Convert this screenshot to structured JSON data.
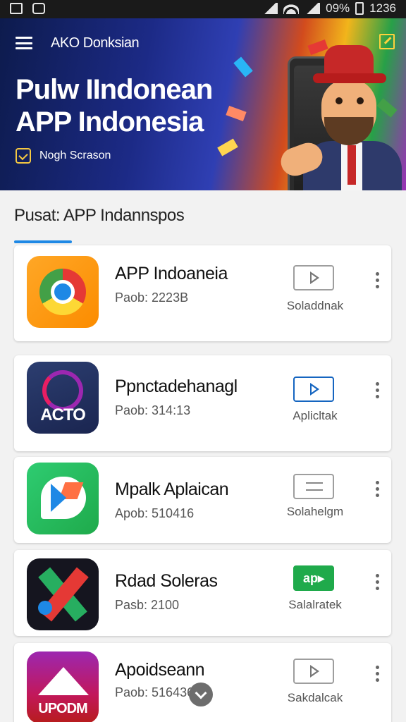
{
  "status_bar": {
    "battery": "09%",
    "time": "1236"
  },
  "banner": {
    "brand": "AKO Donksian",
    "title_line1": "Pulw IIndonean",
    "title_line2": "APP Indonesia",
    "subtitle": "Nogh Scrason"
  },
  "section": {
    "title": "Pusat:  APP Indannspos"
  },
  "apps": [
    {
      "name": "APP Indoaneia",
      "meta": "Paob: 2223B",
      "action": "Soladdnak"
    },
    {
      "name": "Ppnctadehanagl",
      "meta": "Paob: 314:13",
      "action": "Aplicltak",
      "icon_text": "ACTO"
    },
    {
      "name": "Mpalk Aplaican",
      "meta": "Apob: 510416",
      "action": "Solahelgm"
    },
    {
      "name": "Rdad Soleras",
      "meta": "Pasb: 2100",
      "action": "Salalratek",
      "button_text": "ap▸"
    },
    {
      "name": "Apoidseann",
      "meta": "Paob: 516436",
      "action": "Sakdalcak",
      "icon_text": "UPODM"
    }
  ],
  "colors": {
    "accent": "#1e88e5",
    "green": "#1faa4b"
  }
}
